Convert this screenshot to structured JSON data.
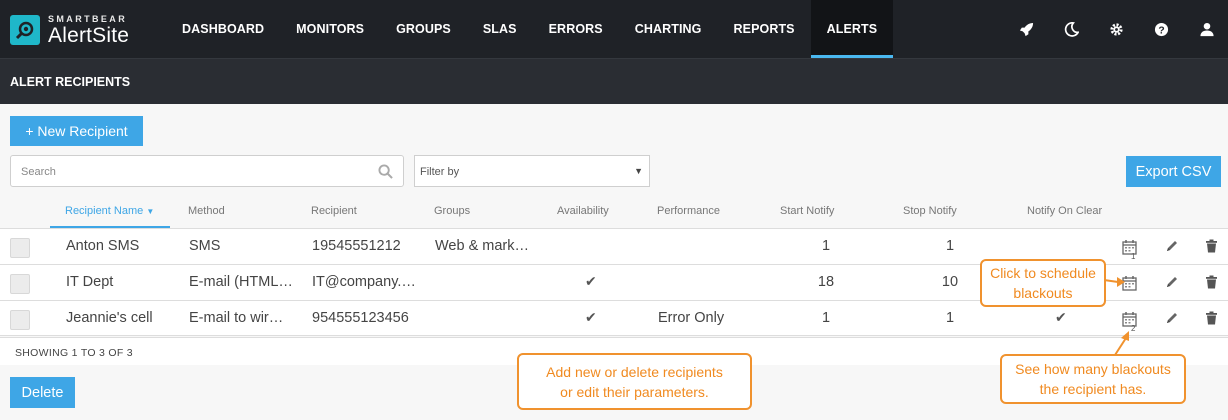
{
  "brand": {
    "small": "SMARTBEAR",
    "big": "AlertSite"
  },
  "nav": {
    "items": [
      {
        "label": "DASHBOARD"
      },
      {
        "label": "MONITORS"
      },
      {
        "label": "GROUPS"
      },
      {
        "label": "SLAS"
      },
      {
        "label": "ERRORS"
      },
      {
        "label": "CHARTING"
      },
      {
        "label": "REPORTS"
      },
      {
        "label": "ALERTS"
      }
    ],
    "active": "ALERTS",
    "icons": [
      "rocket-icon",
      "moon-icon",
      "gear-icon",
      "help-icon",
      "user-icon"
    ]
  },
  "page": {
    "title": "ALERT RECIPIENTS"
  },
  "toolbar": {
    "new_label": "+ New Recipient",
    "export_label": "Export CSV",
    "delete_label": "Delete",
    "search_placeholder": "Search",
    "filter_placeholder": "Filter by"
  },
  "table": {
    "headers": {
      "name": "Recipient Name",
      "method": "Method",
      "recipient": "Recipient",
      "groups": "Groups",
      "availability": "Availability",
      "performance": "Performance",
      "start": "Start Notify",
      "stop": "Stop Notify",
      "clear": "Notify On Clear"
    },
    "rows": [
      {
        "name": "Anton SMS",
        "method": "SMS",
        "recipient": "19545551212",
        "groups": "Web & mark…",
        "availability": "",
        "performance": "",
        "start": "1",
        "stop": "1",
        "clear": "",
        "blackouts": "1"
      },
      {
        "name": "IT Dept",
        "method": "E-mail (HTML…",
        "recipient": "IT@company.…",
        "groups": "",
        "availability": "✔",
        "performance": "",
        "start": "18",
        "stop": "10",
        "clear": "",
        "blackouts": ""
      },
      {
        "name": "Jeannie's cell",
        "method": "E-mail to wir…",
        "recipient": "954555123456",
        "groups": "",
        "availability": "✔",
        "performance": "Error Only",
        "start": "1",
        "stop": "1",
        "clear": "✔",
        "blackouts": "2"
      }
    ],
    "showing": "SHOWING 1 TO 3 OF 3"
  },
  "callouts": {
    "schedule_line1": "Click to schedule",
    "schedule_line2": "blackouts",
    "edit_line1": "Add new or delete recipients",
    "edit_line2": "or edit  their parameters.",
    "count_line1": "See how many blackouts",
    "count_line2": "the recipient has."
  },
  "colors": {
    "accent": "#3ea6e6",
    "callout": "#f0922e",
    "navbar": "#1f2227"
  }
}
